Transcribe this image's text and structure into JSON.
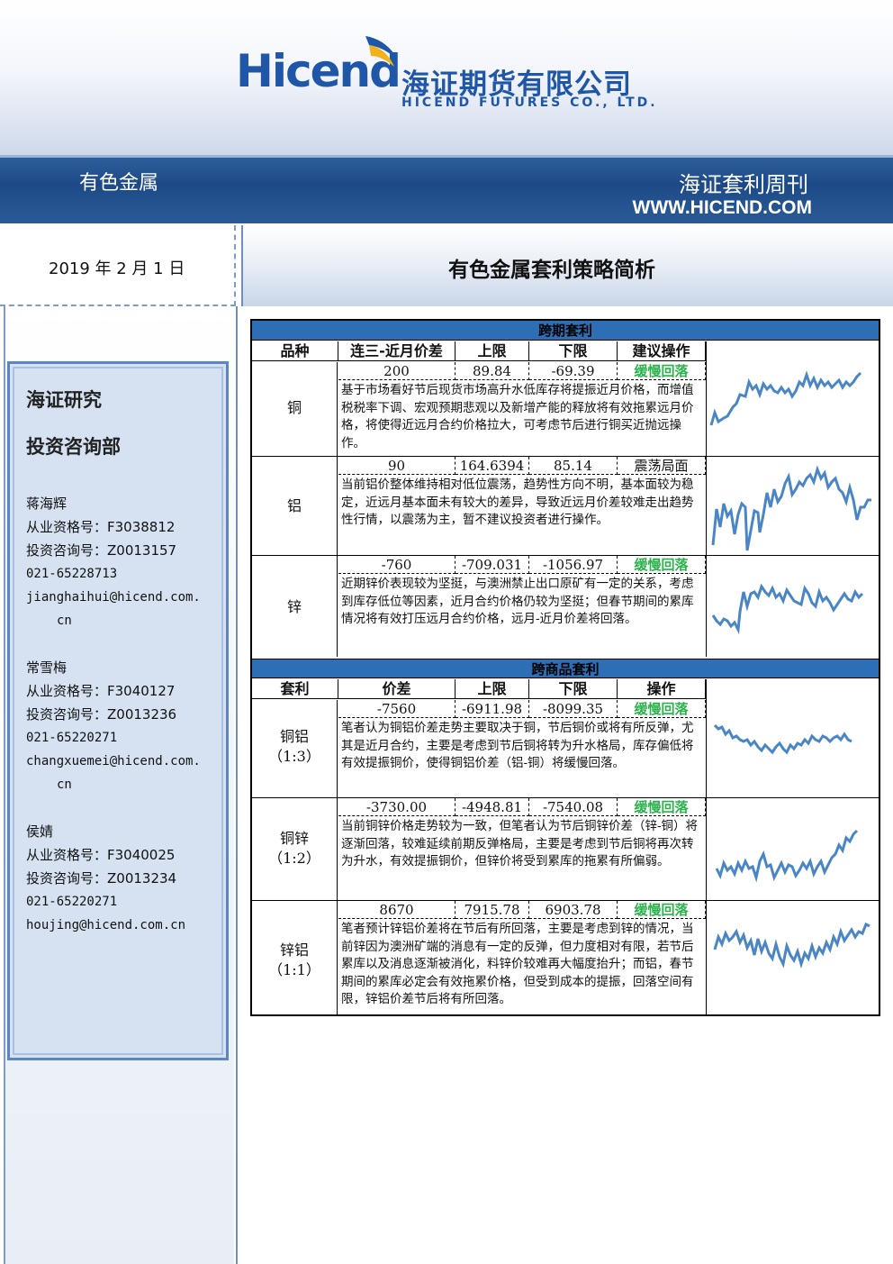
{
  "header": {
    "logo_latin": "Hicend",
    "logo_cn": "海证期货有限公司",
    "logo_en": "HICEND  FUTURES  CO.,  LTD.",
    "category": "有色金属",
    "publication": "海证套利周刊",
    "url": "WWW.HICEND.COM"
  },
  "date": "2019 年 2 月 1 日",
  "title": "有色金属套利策略简析",
  "sidebar": {
    "dept_line1": "海证研究",
    "dept_line2": "投资咨询部",
    "analysts": [
      {
        "name": "蒋海辉",
        "qual": "从业资格号：F3038812",
        "invest": "投资咨询号：Z0013157",
        "phone": "021-65228713",
        "email1": "jianghaihui@hicend.com.",
        "email2": "cn"
      },
      {
        "name": "常雪梅",
        "qual": "从业资格号：F3040127",
        "invest": "投资咨询号：Z0013236",
        "phone": "021-65220271",
        "email1": "changxuemei@hicend.com.",
        "email2": "cn"
      },
      {
        "name": "侯婧",
        "qual": "从业资格号：F3040025",
        "invest": "投资咨询号：Z0013234",
        "phone": "021-65220271",
        "email1": "houjing@hicend.com.cn",
        "email2": ""
      }
    ]
  },
  "intertemporal": {
    "section_title": "跨期套利",
    "columns": [
      "品种",
      "连三-近月价差",
      "上限",
      "下限",
      "建议操作"
    ],
    "rows": [
      {
        "label": "铜",
        "label2": "",
        "spread": "200",
        "upper": "89.84",
        "lower": "-69.39",
        "action": "缓慢回落",
        "action_color": "green",
        "desc": "基于市场看好节后现货市场高升水低库存将提振近月价格，而增值税税率下调、宏观预期悲观以及新增产能的释放将有效拖累远月价格，将使得近远月合约价格拉大，可考虑节后进行铜买近抛远操作。"
      },
      {
        "label": "铝",
        "label2": "",
        "spread": "90",
        "upper": "164.6394",
        "lower": "85.14",
        "action": "震荡局面",
        "action_color": "black",
        "desc": "当前铝价整体维持相对低位震荡，趋势性方向不明，基本面较为稳定，近远月基本面未有较大的差异，导致近远月价差较难走出趋势性行情，以震荡为主，暂不建议投资者进行操作。"
      },
      {
        "label": "锌",
        "label2": "",
        "spread": "-760",
        "upper": "-709.031",
        "lower": "-1056.97",
        "action": "缓慢回落",
        "action_color": "green",
        "desc": "近期锌价表现较为坚挺，与澳洲禁止出口原矿有一定的关系，考虑到库存低位等因素，近月合约价格仍较为坚挺；但春节期间的累库情况将有效打压远月合约价格，远月-近月价差将回落。"
      }
    ]
  },
  "intercommodity": {
    "section_title": "跨商品套利",
    "columns": [
      "套利",
      "价差",
      "上限",
      "下限",
      "操作"
    ],
    "rows": [
      {
        "label": "铜铝",
        "label2": "（1:3）",
        "spread": "-7560",
        "upper": "-6911.98",
        "lower": "-8099.35",
        "action": "缓慢回落",
        "action_color": "green",
        "desc": "笔者认为铜铝价差走势主要取决于铜，节后铜价或将有所反弹，尤其是近月合约，主要是考虑到节后铜将转为升水格局，库存偏低将有效提振铜价，使得铜铝价差（铝-铜）将缓慢回落。"
      },
      {
        "label": "铜锌",
        "label2": "（1:2）",
        "spread": "-3730.00",
        "upper": "-4948.81",
        "lower": "-7540.08",
        "action": "缓慢回落",
        "action_color": "green",
        "desc": "当前铜锌价格走势较为一致，但笔者认为节后铜锌价差（锌-铜）将逐渐回落，较难延续前期反弹格局，主要是考虑到节后铜将再次转为升水，有效提振铜价，但锌价将受到累库的拖累有所偏弱。"
      },
      {
        "label": "锌铝",
        "label2": "（1:1）",
        "spread": "8670",
        "upper": "7915.78",
        "lower": "6903.78",
        "action": "缓慢回落",
        "action_color": "green",
        "desc": "笔者预计锌铝价差将在节后有所回落，主要是考虑到锌的情况，当前锌因为澳洲矿端的消息有一定的反弹，但力度相对有限，若节后累库以及消息逐渐被消化，料锌价较难再大幅度抬升；而铝，春节期间的累库必定会有效拖累价格，但受到成本的提振，回落空间有限，锌铝价差节后将有所回落。"
      }
    ]
  },
  "colors": {
    "brand_blue": "#1f56a7",
    "section_blue": "#2d6eb5",
    "green_action": "#2bb24c",
    "line_blue": "#4a86c5"
  }
}
